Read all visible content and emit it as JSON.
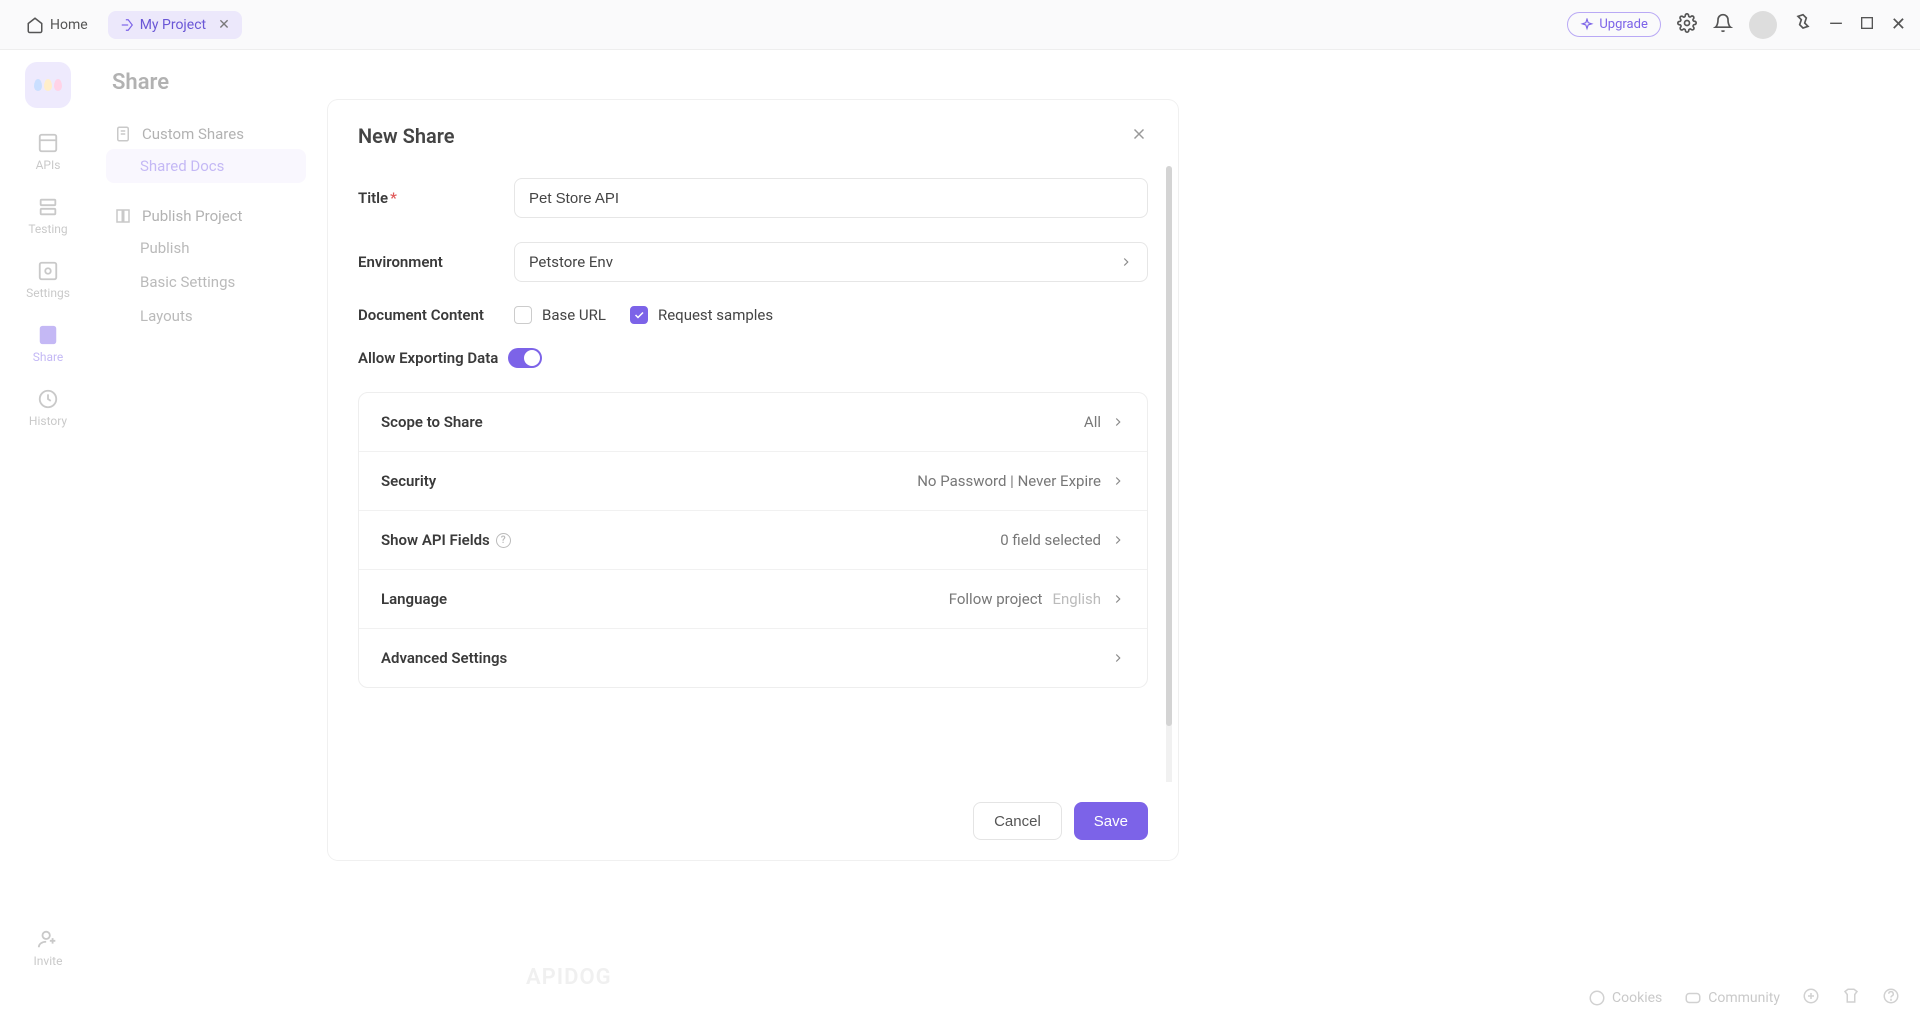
{
  "topbar": {
    "home_label": "Home",
    "project_label": "My Project",
    "upgrade_label": "Upgrade"
  },
  "left_rail": {
    "items": [
      "APIs",
      "Testing",
      "Settings",
      "Share",
      "History"
    ],
    "invite_label": "Invite"
  },
  "sidebar": {
    "title": "Share",
    "custom_shares": "Custom Shares",
    "shared_docs": "Shared Docs",
    "publish_project": "Publish Project",
    "publish": "Publish",
    "basic_settings": "Basic Settings",
    "layouts": "Layouts"
  },
  "bottom": {
    "cookies": "Cookies",
    "community": "Community"
  },
  "watermark": "APIDOG",
  "modal": {
    "title": "New Share",
    "labels": {
      "title": "Title",
      "environment": "Environment",
      "document_content": "Document Content",
      "allow_exporting": "Allow Exporting Data"
    },
    "title_value": "Pet Store API",
    "environment_value": "Petstore Env",
    "checkboxes": {
      "base_url": "Base URL",
      "request_samples": "Request samples"
    },
    "settings": {
      "scope": {
        "name": "Scope to Share",
        "value": "All"
      },
      "security": {
        "name": "Security",
        "value": "No Password | Never Expire"
      },
      "api_fields": {
        "name": "Show API Fields",
        "value": "0 field selected"
      },
      "language": {
        "name": "Language",
        "value_main": "Follow project",
        "value_sub": "English"
      },
      "advanced": {
        "name": "Advanced Settings"
      }
    },
    "buttons": {
      "cancel": "Cancel",
      "save": "Save"
    }
  }
}
